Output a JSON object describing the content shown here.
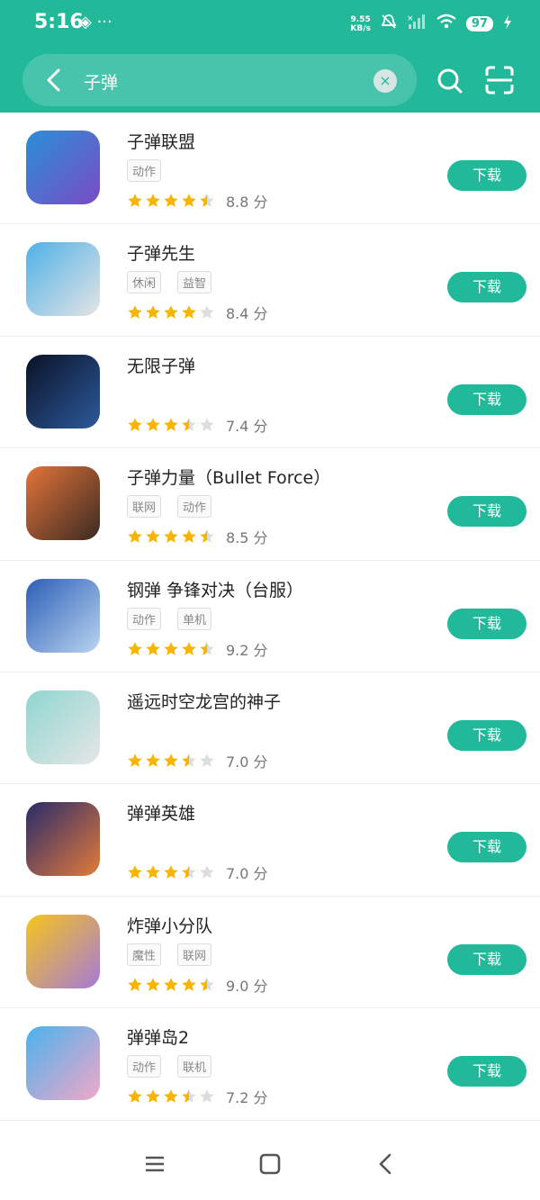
{
  "status_bar": {
    "time": "5:16",
    "left_icons": "◈ ···",
    "net_speed_value": "9.55",
    "net_speed_unit": "KB/s",
    "battery": "97"
  },
  "search": {
    "value": "子弹"
  },
  "colors": {
    "accent": "#22b89a",
    "star": "#f7b500",
    "star_empty": "#dddddd"
  },
  "download_label": "下载",
  "score_unit": "分",
  "apps": [
    {
      "name": "子弹联盟",
      "tags": [
        "动作"
      ],
      "stars": 4.5,
      "score": "8.8",
      "icon_bg": [
        "#2a8fd8",
        "#7b4bc4"
      ]
    },
    {
      "name": "子弹先生",
      "tags": [
        "休闲",
        "益智"
      ],
      "stars": 4,
      "score": "8.4",
      "icon_bg": [
        "#4fb1e8",
        "#e4e4e4"
      ]
    },
    {
      "name": "无限子弹",
      "tags": [],
      "stars": 3.5,
      "score": "7.4",
      "icon_bg": [
        "#0a1226",
        "#2c5a9c"
      ]
    },
    {
      "name": "子弹力量（Bullet Force）",
      "tags": [
        "联网",
        "动作"
      ],
      "stars": 4.5,
      "score": "8.5",
      "icon_bg": [
        "#e3743a",
        "#3a2a22"
      ]
    },
    {
      "name": "钢弹 争锋对决（台服）",
      "tags": [
        "动作",
        "单机"
      ],
      "stars": 4.5,
      "score": "9.2",
      "icon_bg": [
        "#2d5fb8",
        "#b9d4ef"
      ]
    },
    {
      "name": "遥远时空龙宫的神子",
      "tags": [],
      "stars": 3.5,
      "score": "7.0",
      "icon_bg": [
        "#8fd6d0",
        "#e6e6e6"
      ]
    },
    {
      "name": "弹弹英雄",
      "tags": [],
      "stars": 3.5,
      "score": "7.0",
      "icon_bg": [
        "#2a2a6a",
        "#e27b3a"
      ]
    },
    {
      "name": "炸弹小分队",
      "tags": [
        "魔性",
        "联网"
      ],
      "stars": 4.5,
      "score": "9.0",
      "icon_bg": [
        "#f6c51b",
        "#a57ad8"
      ]
    },
    {
      "name": "弹弹岛2",
      "tags": [
        "动作",
        "联机"
      ],
      "stars": 3.5,
      "score": "7.2",
      "icon_bg": [
        "#4ab2ee",
        "#f2a8c8"
      ]
    }
  ],
  "nav": {
    "menu_icon": "menu-icon",
    "home_icon": "home-icon",
    "back_icon": "back-icon"
  }
}
